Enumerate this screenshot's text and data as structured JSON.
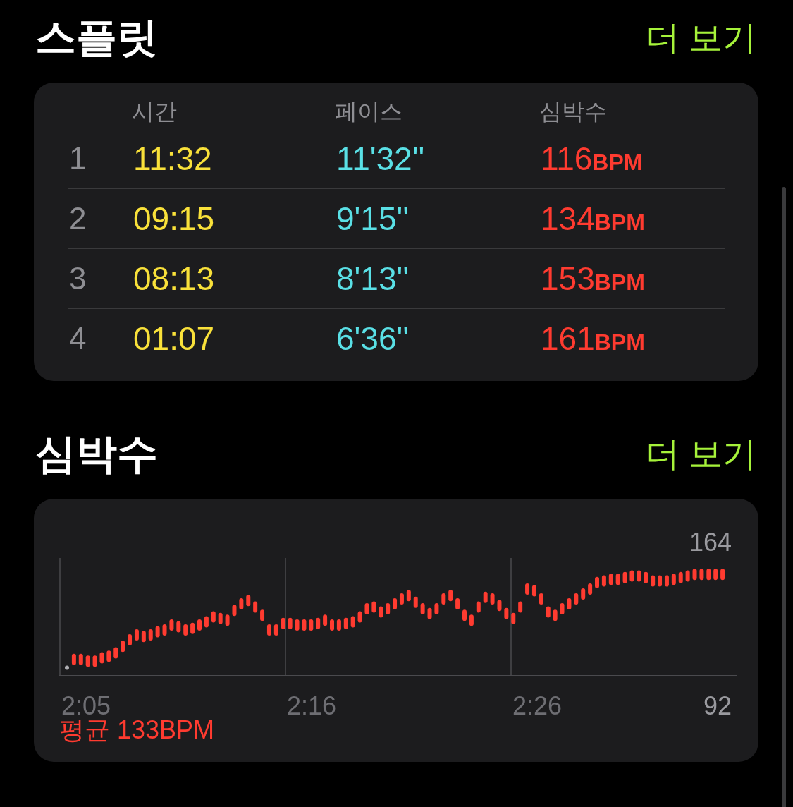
{
  "splits": {
    "title": "스플릿",
    "more_link": "더 보기",
    "columns": [
      "시간",
      "페이스",
      "심박수"
    ],
    "rows": [
      {
        "index": "1",
        "time": "11:32",
        "pace": "11'32''",
        "heart_rate": "116",
        "unit": "BPM"
      },
      {
        "index": "2",
        "time": "09:15",
        "pace": "9'15''",
        "heart_rate": "134",
        "unit": "BPM"
      },
      {
        "index": "3",
        "time": "08:13",
        "pace": "8'13''",
        "heart_rate": "153",
        "unit": "BPM"
      },
      {
        "index": "4",
        "time": "01:07",
        "pace": "6'36''",
        "heart_rate": "161",
        "unit": "BPM"
      }
    ]
  },
  "heart_rate": {
    "title": "심박수",
    "more_link": "더 보기",
    "max_label": "164",
    "min_label": "92",
    "time_labels": [
      "2:05",
      "2:16",
      "2:26"
    ],
    "average": "평균 133BPM"
  }
}
